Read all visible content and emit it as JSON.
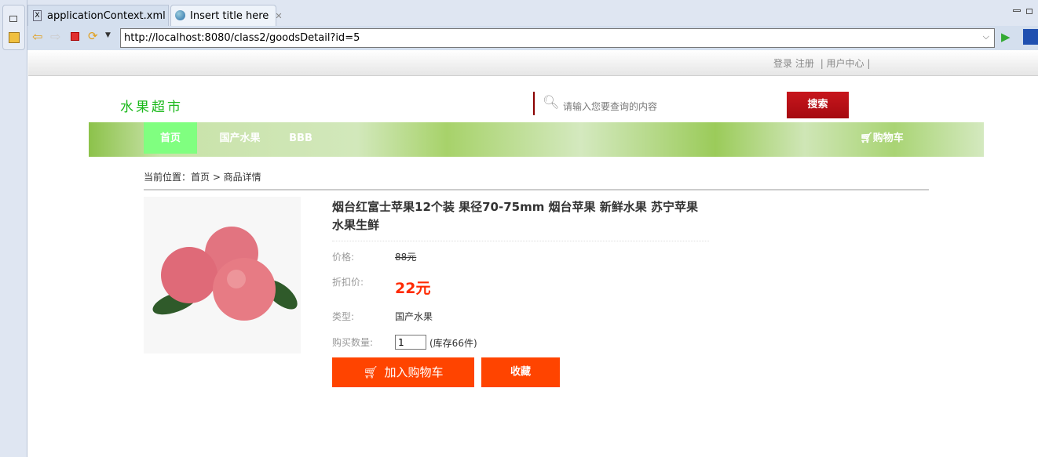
{
  "ide": {
    "tabs": [
      {
        "label": "applicationContext.xml",
        "icon": "xml-file-icon"
      },
      {
        "label": "Insert title here",
        "icon": "globe-icon",
        "active": true
      }
    ]
  },
  "browser": {
    "url": "http://localhost:8080/class2/goodsDetail?id=5"
  },
  "site": {
    "top_links": {
      "login": "登录",
      "register": "注册",
      "user_center": "| 用户中心 |"
    },
    "logo": "水果超市",
    "search": {
      "placeholder": "请输入您要查询的内容",
      "button": "搜索"
    },
    "nav": {
      "items": [
        "首页",
        "国产水果",
        "BBB"
      ],
      "active": "首页",
      "cart": "购物车"
    },
    "breadcrumb": "当前位置：首页 > 商品详情",
    "product": {
      "title": "烟台红富士苹果12个装 果径70-75mm 烟台苹果 新鲜水果 苏宁苹果 水果生鲜",
      "price_label": "价格:",
      "price": "88元",
      "discount_label": "折扣价:",
      "discount": "22元",
      "type_label": "类型:",
      "type": "国产水果",
      "qty_label": "购买数量:",
      "qty": "1",
      "stock": "(库存66件)",
      "add_cart": "加入购物车",
      "favorite": "收藏"
    },
    "colors": {
      "accent": "#ff4400",
      "discount": "#ff2a00",
      "search_button": "#b50d13",
      "nav_active": "#80ff80"
    }
  }
}
